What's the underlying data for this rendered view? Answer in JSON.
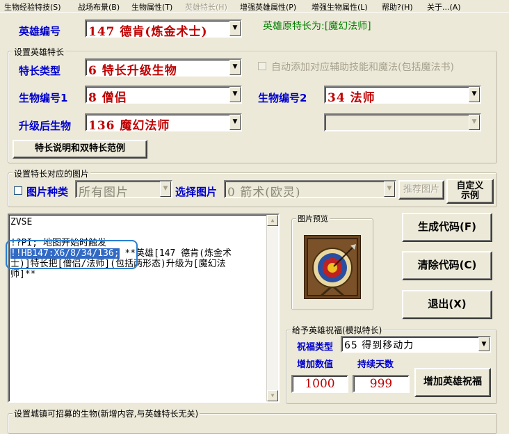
{
  "menu": [
    "生物经验特技(S)",
    "战场布景(B)",
    "生物属性(T)",
    "英雄特长(H)",
    "增强英雄属性(P)",
    "增强生物属性(L)",
    "帮助?(H)",
    "关于...(A)"
  ],
  "hero": {
    "label": "英雄编号",
    "value": "147 德肯(炼金术士)",
    "original_specialty": "英雄原特长为:[魔幻法师]"
  },
  "specialty_group": {
    "title": "设置英雄特长",
    "type_label": "特长类型",
    "type_value": "6 特长升级生物",
    "auto_add_label": "自动添加对应辅助技能和魔法(包括魔法书)",
    "creature1_label": "生物编号1",
    "creature1_value": "8 僧侣",
    "creature2_label": "生物编号2",
    "creature2_value": "34 法师",
    "upgrade_label": "升级后生物",
    "upgrade_value": "136 魔幻法师",
    "upgrade2_value": "",
    "help_button": "特长说明和双特长范例"
  },
  "image_group": {
    "title": "设置特长对应的图片",
    "category_label": "图片种类",
    "category_value": "所有图片",
    "select_label": "选择图片",
    "select_value": "0 箭术(欧灵)",
    "recommend_button": "推荐图片",
    "custom_button_line1": "自定义",
    "custom_button_line2": "示例"
  },
  "editor": {
    "line1": "ZVSE",
    "line2": "!?PI; 地图开始时触发",
    "line3_highlight": "!!HB147:X6/8/34/136;",
    "line3_rest": " **英雄[147 德肯(炼金术",
    "line4": "士)]特长把[僧侣/法师](包括两形态)升级为[魔幻法",
    "line5": "师]**"
  },
  "preview": {
    "title": "图片预览",
    "icon": "archery-target-icon"
  },
  "actions": {
    "generate": "生成代码(F)",
    "clear": "清除代码(C)",
    "exit": "退出(X)"
  },
  "blessing_group": {
    "title": "给予英雄祝福(模拟特长)",
    "type_label": "祝福类型",
    "type_value": "65 得到移动力",
    "amount_label": "增加数值",
    "amount_value": "1000",
    "days_label": "持续天数",
    "days_value": "999",
    "add_button": "增加英雄祝福"
  },
  "town_group": {
    "title": "设置城镇可招募的生物(新增内容,与英雄特长无关)"
  },
  "colors": {
    "accent_blue": "#0000cc",
    "value_red": "#c00000",
    "green": "#008000",
    "selection": "#316ac5"
  }
}
